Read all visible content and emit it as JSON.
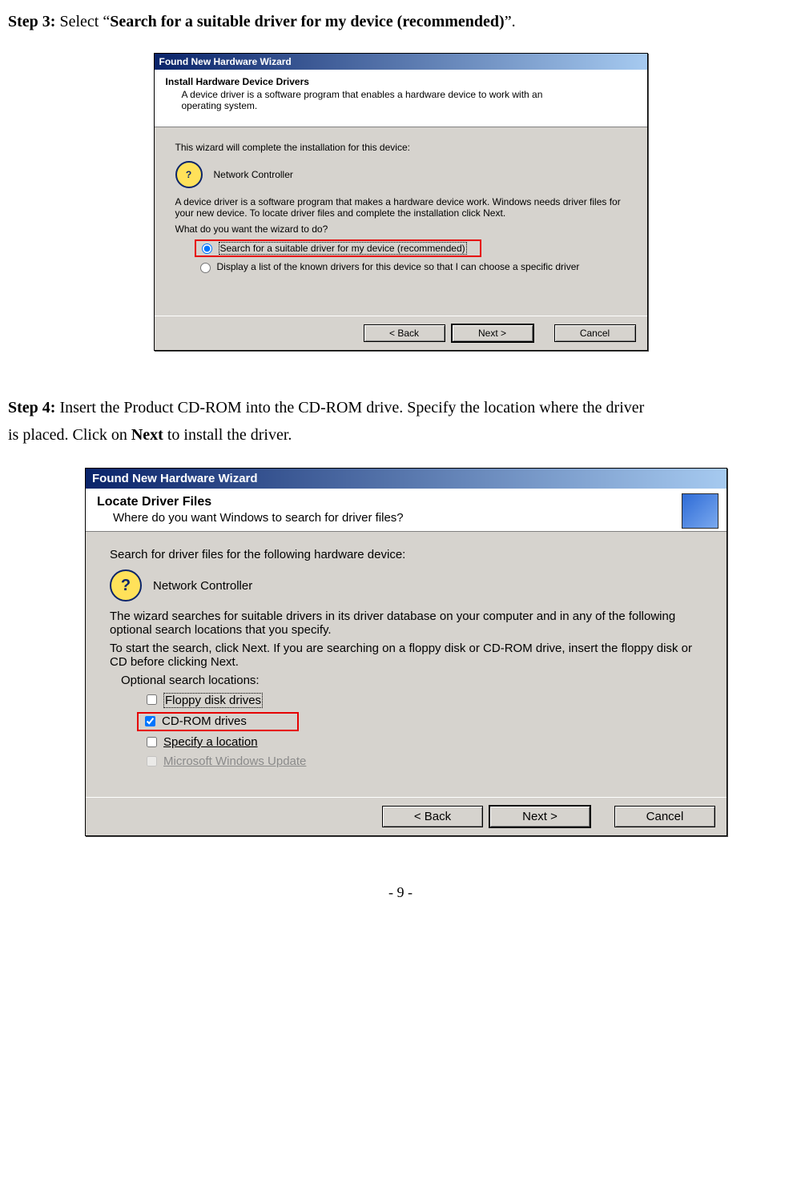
{
  "step3": {
    "label": "Step 3:",
    "text_before": " Select “",
    "bold_text": "Search for a suitable driver for my device (recommended)",
    "text_after": "”."
  },
  "step4": {
    "label": "Step 4:",
    "text1": " Insert the Product CD-ROM into the CD-ROM drive. Specify the location where the driver",
    "text2": "is placed. Click on ",
    "bold_next": "Next",
    "text3": " to install the driver."
  },
  "dialog1": {
    "title": "Found New Hardware Wizard",
    "header_title": "Install Hardware Device Drivers",
    "header_sub": "A device driver is a software program that enables a hardware device to work with an operating system.",
    "line_complete": "This wizard will complete the installation for this device:",
    "device_name": "Network Controller",
    "explain": "A device driver is a software program that makes a hardware device work. Windows needs driver files for your new device. To locate driver files and complete the installation click Next.",
    "question": "What do you want the wizard to do?",
    "option1": "Search for a suitable driver for my device (recommended)",
    "option2": "Display a list of the known drivers for this device so that I can choose a specific driver",
    "back": "< Back",
    "next": "Next >",
    "cancel": "Cancel",
    "qmark": "?"
  },
  "dialog2": {
    "title": "Found New Hardware Wizard",
    "header_title": "Locate Driver Files",
    "header_sub": "Where do you want Windows to search for driver files?",
    "line_search": "Search for driver files for the following hardware device:",
    "device_name": "Network Controller",
    "explain1": "The wizard searches for suitable drivers in its driver database on your computer and in any of the following optional search locations that you specify.",
    "explain2": "To start the search, click Next. If you are searching on a floppy disk or CD-ROM drive, insert the floppy disk or CD before clicking Next.",
    "optional_heading": "Optional search locations:",
    "opt_floppy": "Floppy disk drives",
    "opt_cdrom": "CD-ROM drives",
    "opt_location": "Specify a location",
    "opt_update": "Microsoft Windows Update",
    "back": "< Back",
    "next": "Next >",
    "cancel": "Cancel",
    "qmark": "?"
  },
  "page_number": "- 9 -"
}
